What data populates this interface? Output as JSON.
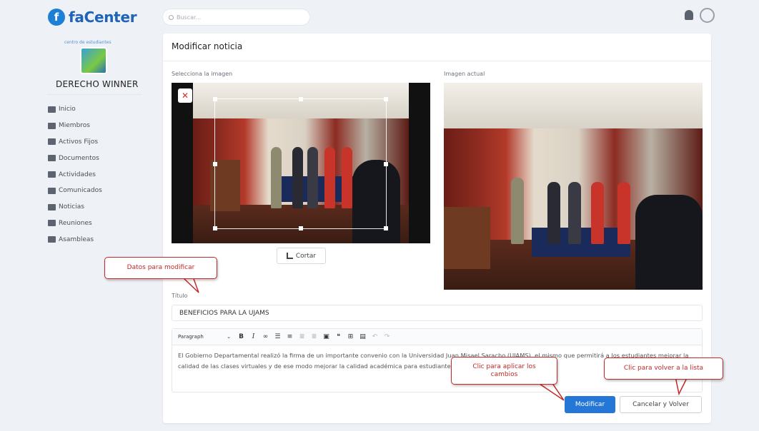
{
  "app": {
    "logo_letter": "f",
    "name": "faCenter"
  },
  "search": {
    "placeholder": "Buscar..."
  },
  "org": {
    "center_label": "centro de estudiantes",
    "name": "DERECHO WINNER"
  },
  "nav": {
    "items": [
      {
        "label": "Inicio",
        "icon": "home-icon"
      },
      {
        "label": "Miembros",
        "icon": "id-card-icon"
      },
      {
        "label": "Activos Fijos",
        "icon": "furniture-icon"
      },
      {
        "label": "Documentos",
        "icon": "folder-icon"
      },
      {
        "label": "Actividades",
        "icon": "calendar-icon"
      },
      {
        "label": "Comunicados",
        "icon": "megaphone-icon"
      },
      {
        "label": "Noticias",
        "icon": "newspaper-icon"
      },
      {
        "label": "Reuniones",
        "icon": "group-icon"
      },
      {
        "label": "Asambleas",
        "icon": "gavel-icon"
      }
    ]
  },
  "page": {
    "title": "Modificar noticia",
    "select_image_label": "Selecciona la imagen",
    "current_image_label": "Imagen actual",
    "crop_button": "Cortar",
    "title_label": "Título",
    "title_value": "BENEFICIOS PARA LA UJAMS",
    "editor": {
      "paragraph_select": "Paragraph",
      "body": "El Gobierno Departamental realizó la firma de un importante convenio con la Universidad Juan Misael Saracho (UJAMS), el mismo que permitirá a los estudiantes mejorar la calidad de las clases virtuales y de ese modo mejorar la calidad académica para estudiantes en el departamento."
    },
    "submit_button": "Modificar",
    "cancel_button": "Cancelar y Volver"
  },
  "annotations": {
    "data_callout": "Datos para modificar",
    "apply_callout": "Clic para aplicar los cambios",
    "back_callout": "Clic para volver a la lista"
  },
  "colors": {
    "primary": "#2477d6",
    "brand": "#1e63b8",
    "callout_red": "#c62828"
  }
}
